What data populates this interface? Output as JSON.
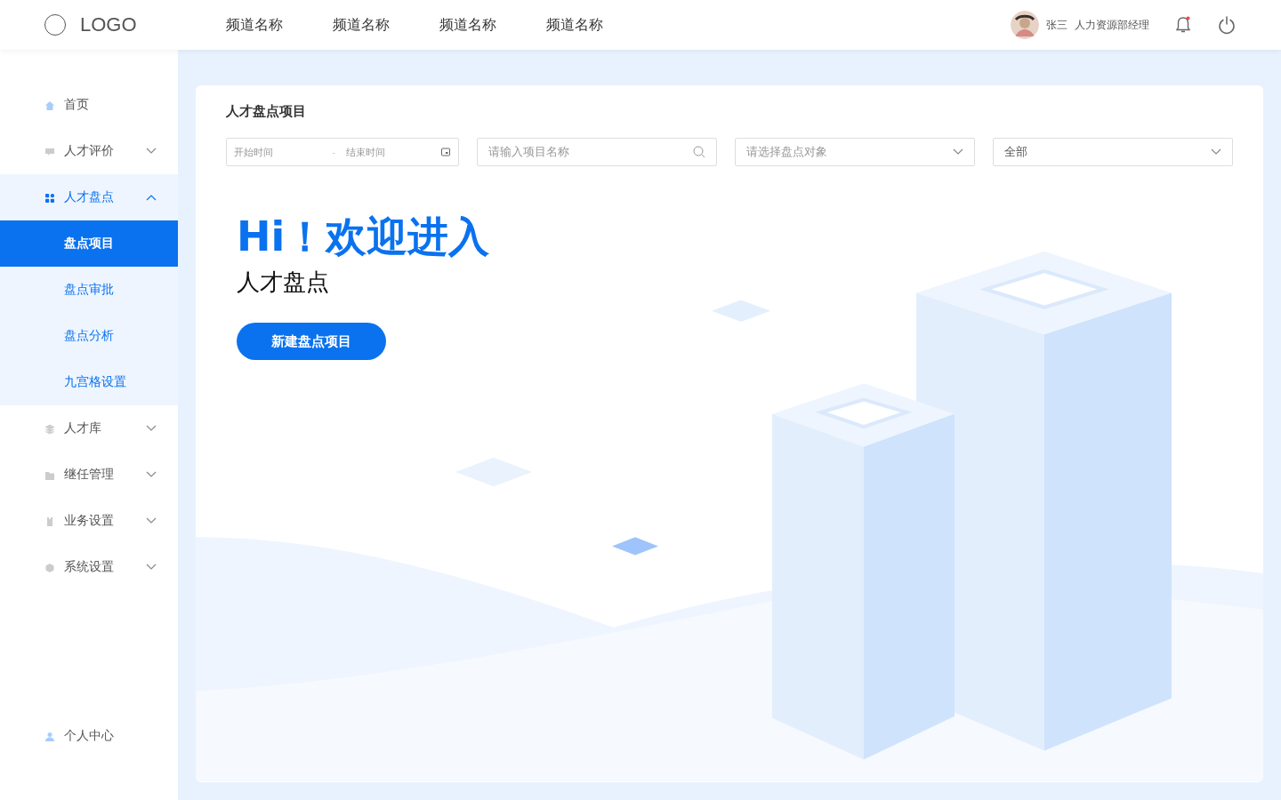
{
  "header": {
    "logo": "LOGO",
    "nav": [
      {
        "label": "频道名称",
        "selected": false
      },
      {
        "label": "频道名称",
        "selected": false
      },
      {
        "label": "频道名称",
        "selected": false
      },
      {
        "label": "频道名称",
        "selected": false
      }
    ],
    "user": {
      "name": "张三",
      "role": "人力资源部经理"
    },
    "notification": {
      "unread": true
    }
  },
  "sidebar": {
    "items": [
      {
        "label": "首页",
        "expandable": false,
        "expanded": false,
        "selected": false
      },
      {
        "label": "人才评价",
        "expandable": true,
        "expanded": false,
        "selected": false
      },
      {
        "label": "人才盘点",
        "expandable": true,
        "expanded": true,
        "selected": true,
        "children": [
          {
            "label": "盘点项目",
            "selected": true
          },
          {
            "label": "盘点审批",
            "selected": false
          },
          {
            "label": "盘点分析",
            "selected": false
          },
          {
            "label": "九宫格设置",
            "selected": false
          }
        ]
      },
      {
        "label": "人才库",
        "expandable": true,
        "expanded": false,
        "selected": false
      },
      {
        "label": "继任管理",
        "expandable": true,
        "expanded": false,
        "selected": false
      },
      {
        "label": "业务设置",
        "expandable": true,
        "expanded": false,
        "selected": false
      },
      {
        "label": "系统设置",
        "expandable": true,
        "expanded": false,
        "selected": false
      }
    ],
    "footer": "个人中心"
  },
  "main": {
    "title": "人才盘点项目",
    "filters": {
      "date_range": {
        "start_placeholder": "开始时间",
        "separator": "-",
        "end_placeholder": "结束时间"
      },
      "search": {
        "placeholder": "请输入项目名称"
      },
      "target_select": {
        "placeholder": "请选择盘点对象"
      },
      "status_select": {
        "value": "全部"
      }
    },
    "welcome": {
      "heading": "Hi！欢迎进入",
      "subheading": "人才盘点",
      "button": "新建盘点项目"
    }
  }
}
